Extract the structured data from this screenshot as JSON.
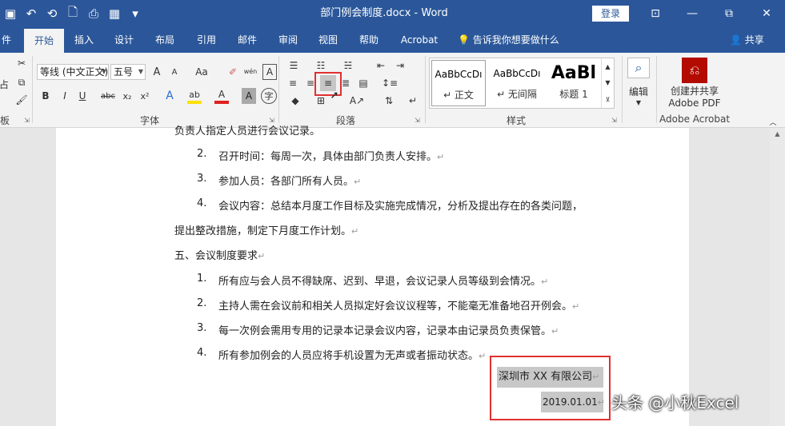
{
  "window": {
    "title": "部门例会制度.docx  -  Word",
    "login": "登录",
    "minimize": "—",
    "restore": "⧉",
    "close": "✕",
    "ribbon_display": "⊡"
  },
  "qat": [
    "▣",
    "↶",
    "⟲",
    "🗋",
    "⎙",
    "▦",
    "▾"
  ],
  "tabs": [
    "件",
    "开始",
    "插入",
    "设计",
    "布局",
    "引用",
    "邮件",
    "审阅",
    "视图",
    "帮助",
    "Acrobat"
  ],
  "active_tab": "开始",
  "tell_me": "告诉我你想要做什么",
  "share": "共享",
  "ribbon": {
    "clipboard": {
      "label": "板",
      "paste": "占"
    },
    "font": {
      "label": "字体",
      "font_name": "等线 (中文正文)",
      "font_size": "五号",
      "grow": "A",
      "shrink": "A",
      "case": "Aa",
      "phonetic": "wén",
      "char_border": "A",
      "bold": "B",
      "italic": "I",
      "underline": "U",
      "strike": "abc",
      "subscript": "x₂",
      "superscript": "x²",
      "effects": "A",
      "highlight": "ab",
      "color": "A",
      "shading": "A",
      "enclose": "字"
    },
    "paragraph": {
      "label": "段落"
    },
    "styles": {
      "label": "样式",
      "items": [
        {
          "sample": "AaBbCcDı",
          "name": "↵ 正文"
        },
        {
          "sample": "AaBbCcDı",
          "name": "↵ 无间隔"
        },
        {
          "sample": "AaBl",
          "name": "标题 1"
        }
      ]
    },
    "editing": {
      "label": "编辑"
    },
    "acrobat": {
      "button": "创建并共享",
      "button2": "Adobe PDF",
      "label": "Adobe Acrobat"
    }
  },
  "document": {
    "cut_line": "负责人指定人员进行会议记录。",
    "items_a": [
      {
        "num": "2.",
        "text": "召开时间：每周一次，具体由部门负责人安排。"
      },
      {
        "num": "3.",
        "text": "参加人员：各部门所有人员。"
      },
      {
        "num": "4.",
        "text": "会议内容：总结本月度工作目标及实施完成情况，分析及提出存在的各类问题，"
      }
    ],
    "continuation": "提出整改措施，制定下月度工作计划。",
    "section5": "五、会议制度要求",
    "items_b": [
      {
        "num": "1.",
        "text": "所有应与会人员不得缺席、迟到、早退，会议记录人员等级到会情况。"
      },
      {
        "num": "2.",
        "text": "主持人需在会议前和相关人员拟定好会议议程等，不能毫无准备地召开例会。"
      },
      {
        "num": "3.",
        "text": "每一次例会需用专用的记录本记录会议内容，记录本由记录员负责保管。"
      },
      {
        "num": "4.",
        "text": "所有参加例会的人员应将手机设置为无声或者振动状态。"
      }
    ],
    "company": "深圳市 XX 有限公司",
    "date": "2019.01.01",
    "para_mark": "↵"
  },
  "watermark": "头条 @小秋Excel"
}
